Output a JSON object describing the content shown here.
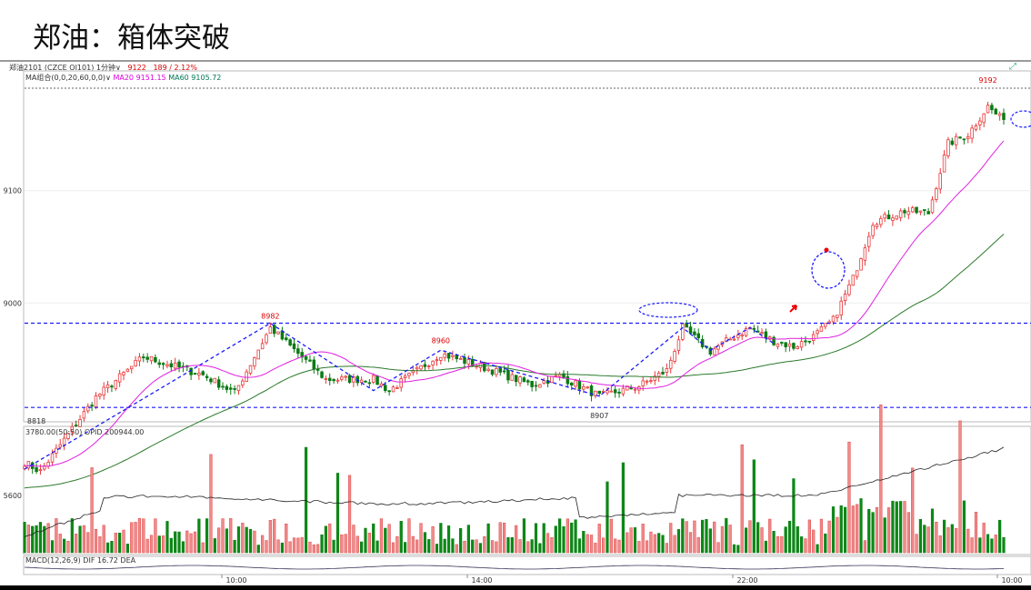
{
  "title": "郑油：箱体突破",
  "info": {
    "symbol": "郑油2101",
    "contract": "(CZCE OI101)",
    "period": "1分钟",
    "last": "9122",
    "change": "189 / 2.12%"
  },
  "ma_legend": {
    "name": "MA组合(0,0,20,60,0,0)",
    "ma20": "MA20 9151.15",
    "ma60": "MA60 9105.72"
  },
  "vol_legend": "3780.00(50:50)  OPID 200944.00",
  "macd_legend": "MACD(12,26,9)  DIF 16.72  DEA",
  "colors": {
    "up": "#e8383a",
    "down": "#0a7a14",
    "ma20": "#e020e0",
    "ma60": "#2a7a2a",
    "box": "#1a1aff",
    "bg": "#ffffff"
  },
  "chart_data": {
    "type": "candlestick",
    "title": "郑油：箱体突破",
    "ylim": [
      8895,
      9205
    ],
    "y_ticks": [
      9000,
      9100
    ],
    "x_ticks": [
      "10:00",
      "14:00",
      "22:00",
      "10:00"
    ],
    "box": {
      "top": 8982,
      "bottom": 8907
    },
    "breakout_level": 9192,
    "labels": [
      {
        "text": "8982",
        "x": 62,
        "y": 8982
      },
      {
        "text": "8960",
        "x": 105,
        "y": 8960
      },
      {
        "text": "8907",
        "x": 145,
        "y": 8907
      },
      {
        "text": "9192",
        "x": 243,
        "y": 9192
      },
      {
        "text": "8818",
        "x": 3,
        "y": 8818
      }
    ],
    "vol_tick": "5600",
    "keypoints": [
      {
        "i": 0,
        "p": 8858
      },
      {
        "i": 4,
        "p": 8850
      },
      {
        "i": 18,
        "p": 8916
      },
      {
        "i": 30,
        "p": 8952
      },
      {
        "i": 45,
        "p": 8936
      },
      {
        "i": 53,
        "p": 8920
      },
      {
        "i": 62,
        "p": 8978
      },
      {
        "i": 76,
        "p": 8932
      },
      {
        "i": 88,
        "p": 8932
      },
      {
        "i": 92,
        "p": 8922
      },
      {
        "i": 105,
        "p": 8955
      },
      {
        "i": 118,
        "p": 8940
      },
      {
        "i": 128,
        "p": 8927
      },
      {
        "i": 135,
        "p": 8935
      },
      {
        "i": 145,
        "p": 8917
      },
      {
        "i": 155,
        "p": 8926
      },
      {
        "i": 162,
        "p": 8940
      },
      {
        "i": 166,
        "p": 8978
      },
      {
        "i": 173,
        "p": 8957
      },
      {
        "i": 178,
        "p": 8968
      },
      {
        "i": 183,
        "p": 8978
      },
      {
        "i": 189,
        "p": 8966
      },
      {
        "i": 194,
        "p": 8961
      },
      {
        "i": 199,
        "p": 8970
      },
      {
        "i": 204,
        "p": 8985
      },
      {
        "i": 209,
        "p": 9022
      },
      {
        "i": 214,
        "p": 9072
      },
      {
        "i": 222,
        "p": 9082
      },
      {
        "i": 228,
        "p": 9080
      },
      {
        "i": 233,
        "p": 9142
      },
      {
        "i": 238,
        "p": 9150
      },
      {
        "i": 243,
        "p": 9175
      },
      {
        "i": 246,
        "p": 9165
      }
    ]
  }
}
